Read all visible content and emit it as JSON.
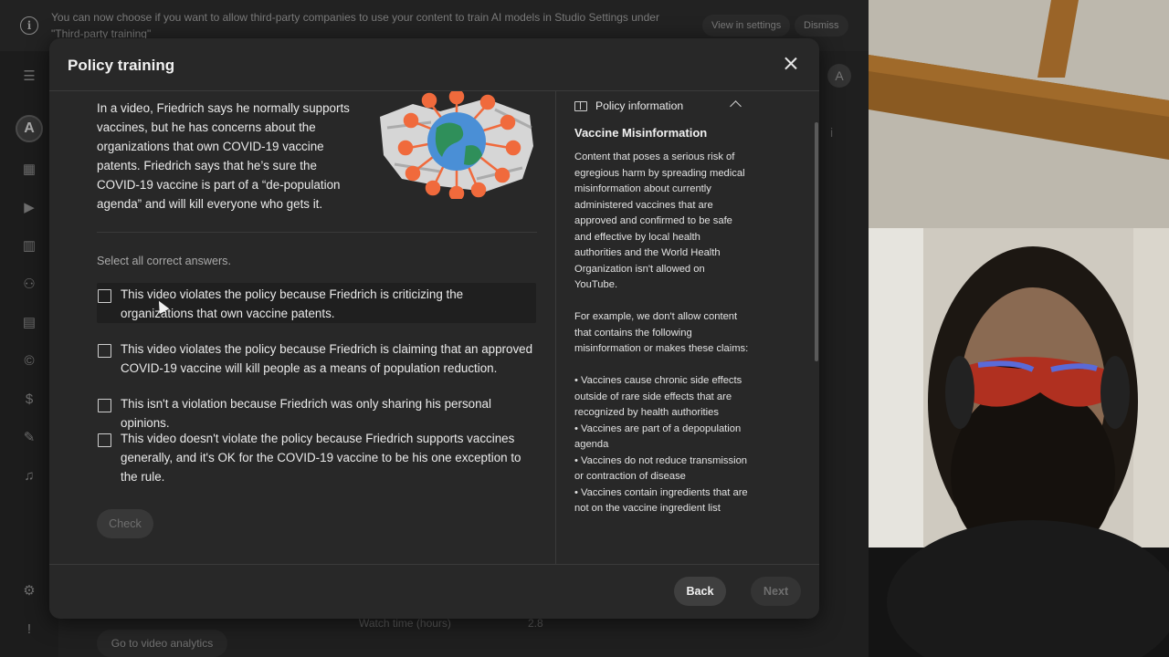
{
  "banner": {
    "message": "You can now choose if you want to allow third-party companies to use your content to train AI models in Studio Settings under \"Third-party training\"",
    "view_settings_label": "View in settings",
    "dismiss_label": "Dismiss"
  },
  "background": {
    "analytics_button": "Go to video analytics",
    "watch_time_label": "Watch time (hours)",
    "watch_time_value": "2.8"
  },
  "modal": {
    "title": "Policy training",
    "scenario": "In a video, Friedrich says he normally supports vaccines, but he has concerns about the organizations that own COVID-19 vaccine patents. Friedrich says that he’s sure the COVID-19 vaccine is part of a “de-population agenda” and will kill everyone who gets it.",
    "select_label": "Select all correct answers.",
    "options": [
      {
        "label": "This video violates the policy because Friedrich is criticizing the organizations that own vaccine patents."
      },
      {
        "label": "This video violates the policy because Friedrich is claiming that an approved COVID-19 vaccine will kill people as a means of population reduction."
      },
      {
        "label": "This isn't a violation because Friedrich was only sharing his personal opinions."
      },
      {
        "label": "This video doesn't violate the policy because Friedrich supports vaccines generally, and it's OK for the COVID-19 vaccine to be his one exception to the rule."
      }
    ],
    "check_label": "Check",
    "back_label": "Back",
    "next_label": "Next"
  },
  "policy": {
    "header": "Policy information",
    "title": "Vaccine Misinformation",
    "intro": "Content that poses a serious risk of egregious harm by spreading medical misinformation about currently administered vaccines that are approved and confirmed to be safe and effective by local health authorities and the World Health Organization isn't allowed on YouTube.",
    "example_intro": "For example, we don't allow content that contains the following misinformation or makes these claims:",
    "bullets": [
      "• Vaccines cause chronic side effects outside of rare side effects that are recognized by health authorities",
      "• Vaccines are part of a depopulation agenda",
      "• Vaccines do not reduce transmission or contraction of disease",
      "• Vaccines contain ingredients that are not on the vaccine ingredient list"
    ]
  },
  "colors": {
    "modal_bg": "#282828",
    "app_bg": "#1f1f1f",
    "illustration_orange": "#f06a3c",
    "globe_blue": "#4a8fd6",
    "globe_green": "#2f8f5a"
  }
}
